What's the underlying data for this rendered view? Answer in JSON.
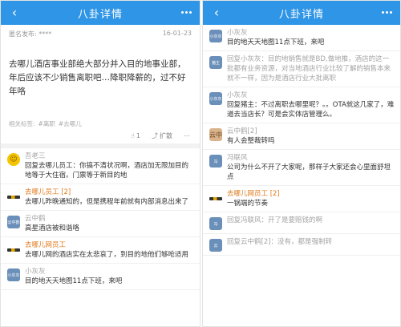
{
  "left": {
    "nav": {
      "back_icon": "‹",
      "title": "八卦详情"
    },
    "post": {
      "author": "匿名发布: ****",
      "date": "16-01-23",
      "body": "去哪儿酒店事业部绝大部分并入目的地事业部，年后应该不少销售离职吧…降职降薪的，过不好年咯",
      "tags_label": "相关标签:",
      "tags": [
        "#离职",
        "#去哪儿"
      ],
      "like_count": "1",
      "share_label": "扩散"
    },
    "comments": [
      {
        "avatar": "smile",
        "name": "吾老三",
        "text": "回复去哪儿员工：你搞不清状况啊，酒店加无限加目的地等于大住宿。门票等于新目的地"
      },
      {
        "avatar": "quna",
        "name": "去哪儿员工 [2]",
        "name_style": "orange",
        "text": "去哪儿昨晚通知的，但是携程年前就有内部消息出来了"
      },
      {
        "avatar": "blue",
        "avatar_text": "云中鹤",
        "name": "云中鹤",
        "text": "高星酒店被和谐咯"
      },
      {
        "avatar": "quna",
        "name": "去哪儿网员工",
        "name_style": "orange",
        "text": "去哪儿网的酒店实在太悲哀了，到目的地他们够呛适用"
      },
      {
        "avatar": "blue",
        "avatar_text": "小灰灰",
        "name": "小灰灰",
        "text": "目的地天天地图11点下班，来吧"
      }
    ]
  },
  "right": {
    "nav": {
      "back_icon": "‹",
      "title": "八卦详情"
    },
    "comments": [
      {
        "avatar": "blue",
        "avatar_text": "小灰灰",
        "name": "小灰灰",
        "text": "目的地天天地图11点下班，来吧"
      },
      {
        "avatar": "blue",
        "avatar_text": "猪主",
        "name": "回复小灰灰：目的地销售就是BD,做地推，酒店的这一批都有业务资源，对当地酒店行业比较了解的销售本来就不一样，因为是酒店行业大批离职",
        "text": ""
      },
      {
        "avatar": "blue",
        "avatar_text": "小灰灰",
        "name": "小灰灰",
        "text": "回复猪主：不过离职去哪里呢？。。OTA就这几家了，难道去当店长？可是会实体店管理么。"
      },
      {
        "avatar": "dog",
        "avatar_text": "云中",
        "name": "云中鹤[2]",
        "text": "有人会整裁转吗"
      },
      {
        "avatar": "blue",
        "avatar_text": "冯",
        "name": "冯联风",
        "text": "公司为什么不开了大家呢，那样子大家还会心里面舒坦点"
      },
      {
        "avatar": "quna",
        "name": "去哪儿网员工 [2]",
        "name_style": "orange",
        "text": "一锅端的节奏"
      },
      {
        "avatar": "blue",
        "avatar_text": "冯",
        "name": "回复冯联风：开了是要赔钱的啊",
        "text": ""
      },
      {
        "avatar": "blue",
        "avatar_text": "云",
        "name": "回复云中鹤[2]：没有，都是强制转",
        "text": ""
      }
    ]
  },
  "colors": {
    "nav_bg": "#2f95e6",
    "orange": "#e07a1c"
  }
}
